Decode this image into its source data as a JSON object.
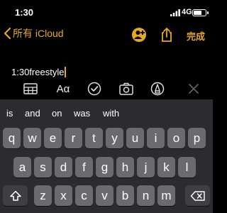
{
  "status_bar": {
    "time": "1:30",
    "network": "4G",
    "battery_level": 0.7
  },
  "nav": {
    "back_label": "所有 iCloud",
    "done_label": "完成"
  },
  "note": {
    "text": "1:30freestyle"
  },
  "toolbar": {
    "text_style_label": "Aα"
  },
  "suggestions": [
    "is",
    "and",
    "on",
    "was",
    "with"
  ],
  "keyboard": {
    "row1": [
      "q",
      "w",
      "e",
      "r",
      "t",
      "y",
      "u",
      "i",
      "o",
      "p"
    ],
    "row2": [
      "a",
      "s",
      "d",
      "f",
      "g",
      "h",
      "j",
      "k",
      "l"
    ],
    "row3": [
      "z",
      "x",
      "c",
      "v",
      "b",
      "n",
      "m"
    ]
  },
  "colors": {
    "accent": "#e5a91f",
    "background": "#000000",
    "keyboard_bg": "#2c2c2e",
    "key": "#6b6b6e",
    "modifier_key": "#3f3f42"
  },
  "icons": [
    "signal-icon",
    "battery-icon",
    "back-chevron-icon",
    "add-people-icon",
    "share-icon",
    "table-icon",
    "checklist-icon",
    "camera-icon",
    "markup-icon",
    "close-icon",
    "shift-icon",
    "backspace-icon"
  ]
}
